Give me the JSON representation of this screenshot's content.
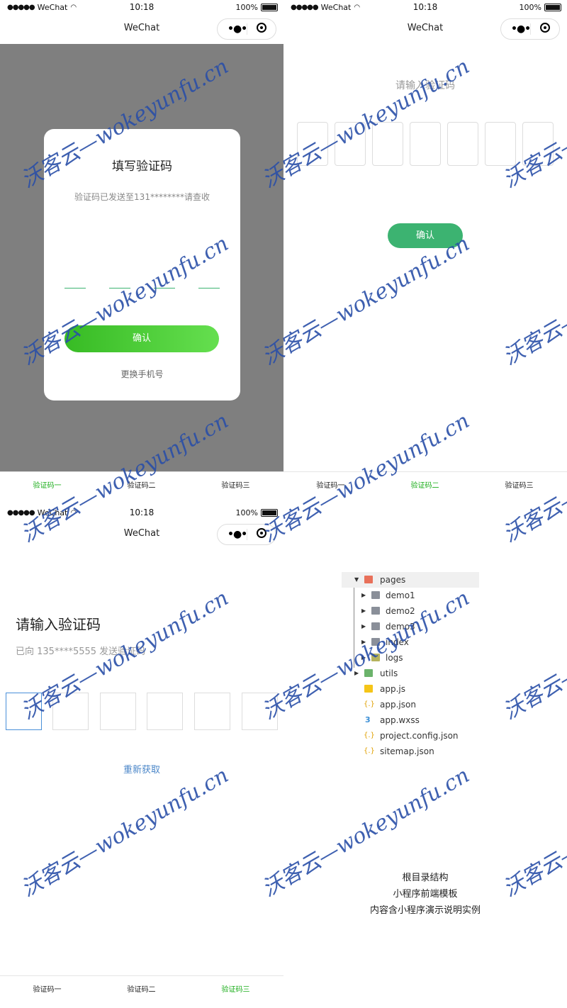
{
  "status": {
    "carrier": "WeChat",
    "time": "10:18",
    "battery": "100%"
  },
  "nav": {
    "title": "WeChat"
  },
  "panel1": {
    "title": "填写验证码",
    "subtitle": "验证码已发送至131********请查收",
    "confirm": "确认",
    "change_phone": "更换手机号"
  },
  "panel2": {
    "title": "请输入验证码",
    "confirm": "确认"
  },
  "panel3": {
    "title": "请输入验证码",
    "subtitle": "已向 135****5555 发送验证码",
    "resend": "重新获取"
  },
  "tabs": {
    "t1": "验证码一",
    "t2": "验证码二",
    "t3": "验证码三"
  },
  "tree": {
    "pages": "pages",
    "demo1": "demo1",
    "demo2": "demo2",
    "demo3": "demo3",
    "index": "index",
    "logs": "logs",
    "utils": "utils",
    "appjs": "app.js",
    "appjson": "app.json",
    "appwxss": "app.wxss",
    "project": "project.config.json",
    "sitemap": "sitemap.json"
  },
  "desc": {
    "l1": "根目录结构",
    "l2": "小程序前端模板",
    "l3": "内容含小程序演示说明实例"
  },
  "watermark": "沃客云—wokeyunfu.cn",
  "colors": {
    "green": "#3cb371",
    "tab_active": "#1aad19",
    "link_blue": "#4a86c8"
  }
}
